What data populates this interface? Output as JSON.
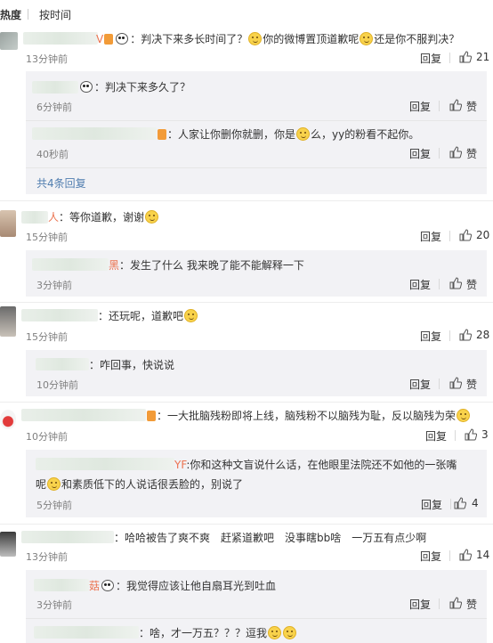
{
  "tabs": {
    "hot": "热度",
    "time": "按时间"
  },
  "actions": {
    "reply": "回复",
    "like": "赞"
  },
  "comments": [
    {
      "name": "V",
      "text": "：判决下来多长时间了？",
      "text2": "你的微博置顶道歉呢",
      "text3": "还是你不服判决？",
      "time": "13分钟前",
      "likes": "21",
      "replies": [
        {
          "text": "：判决下来多久了？",
          "time": "6分钟前"
        },
        {
          "text": "：人家让你删你就删，你是",
          "text2": "么，yy的粉看不起你。",
          "time": "40秒前"
        }
      ],
      "more": "共4条回复"
    },
    {
      "name": "人",
      "text": "：等你道歉，谢谢",
      "time": "15分钟前",
      "likes": "20",
      "replies": [
        {
          "name": "黑",
          "text": "：发生了什么 我来晚了能不能解释一下",
          "time": "3分钟前"
        }
      ]
    },
    {
      "text": "：还玩呢，道歉吧",
      "time": "15分钟前",
      "likes": "28",
      "replies": [
        {
          "text": "：咋回事，快说说",
          "time": "10分钟前"
        }
      ]
    },
    {
      "text": "：一大批脑残粉即将上线，脑残粉不以脑残为耻，反以脑残为荣",
      "time": "10分钟前",
      "likes": "3",
      "replies": [
        {
          "name": "YF",
          "text": ":你和这种文盲说什么话，在他眼里法院还不如他的一张嘴",
          "text2": "呢",
          "text3": "和素质低下的人说话很丢脸的，别说了",
          "time": "5分钟前",
          "likes": "4"
        }
      ]
    },
    {
      "text": "：哈哈被告了爽不爽　赶紧道歉吧　没事瞎bb啥　一万五有点少啊",
      "time": "13分钟前",
      "likes": "14",
      "replies": [
        {
          "name": "菇",
          "text": "：我觉得应该让他自扇耳光到吐血",
          "time": "3分钟前"
        },
        {
          "text": "：啥，才一万五？？？逗我",
          "time": ""
        }
      ]
    }
  ]
}
